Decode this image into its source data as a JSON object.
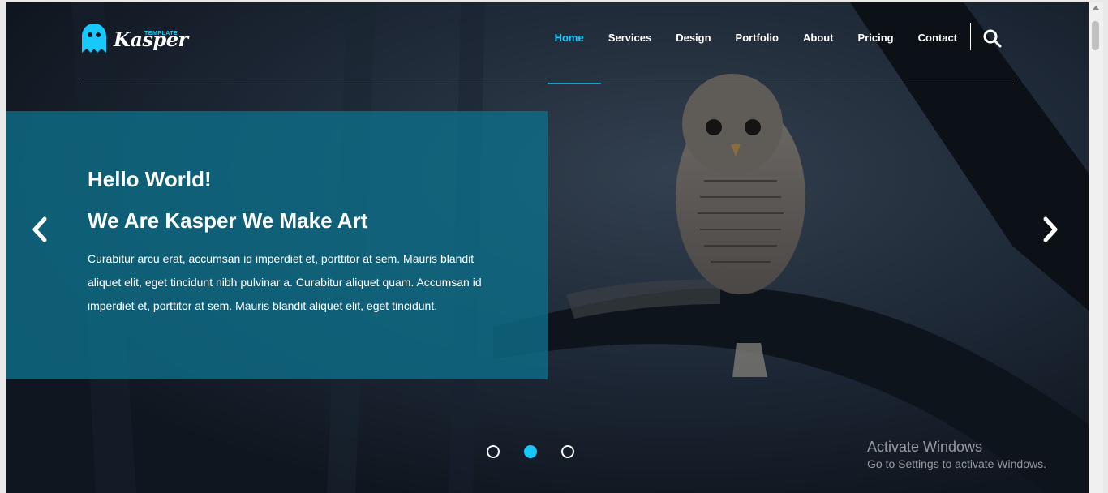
{
  "brand": {
    "name": "Kasper",
    "tagline": "TEMPLATE",
    "accent": "#19c8fa"
  },
  "nav": {
    "items": [
      {
        "label": "Home",
        "active": true
      },
      {
        "label": "Services",
        "active": false
      },
      {
        "label": "Design",
        "active": false
      },
      {
        "label": "Portfolio",
        "active": false
      },
      {
        "label": "About",
        "active": false
      },
      {
        "label": "Pricing",
        "active": false
      },
      {
        "label": "Contact",
        "active": false
      }
    ],
    "search_icon": "search-icon"
  },
  "hero": {
    "title": "Hello World!",
    "subtitle": "We Are Kasper We Make Art",
    "body": "Curabitur arcu erat, accumsan id imperdiet et, porttitor at sem. Mauris blandit aliquet elit, eget tincidunt nibh pulvinar a. Curabitur aliquet quam. Accumsan id imperdiet et, porttitor at sem. Mauris blandit aliquet elit, eget tincidunt.",
    "panel_color": "#0e6c87",
    "prev_icon": "chevron-left-icon",
    "next_icon": "chevron-right-icon"
  },
  "slider": {
    "slide_count": 3,
    "active_index": 1
  },
  "watermark": {
    "line1": "Activate Windows",
    "line2": "Go to Settings to activate Windows."
  }
}
